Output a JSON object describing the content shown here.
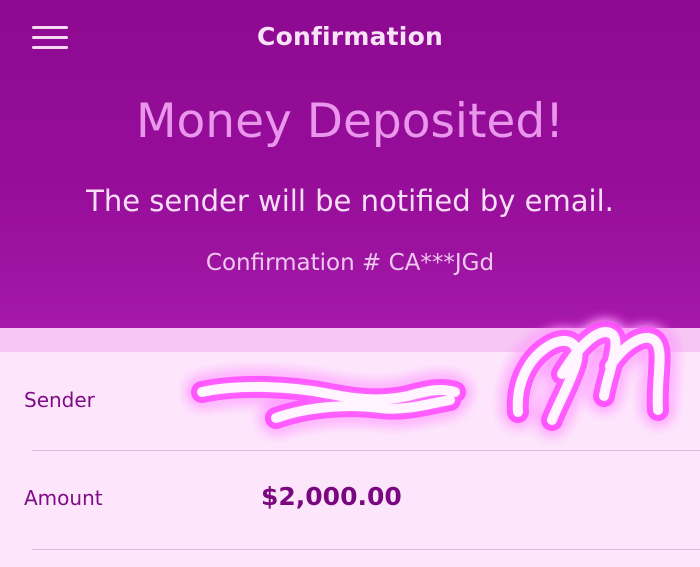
{
  "nav": {
    "title": "Confirmation",
    "menu_icon": "hamburger-menu-icon"
  },
  "confirmation": {
    "headline": "Money Deposited!",
    "message": "The sender will be notified by email.",
    "number_text": "Confirmation # CA***JGd"
  },
  "details": {
    "sender_label": "Sender",
    "amount_label": "Amount",
    "amount_value": "$2,000.00"
  },
  "colors": {
    "header_bg": "#8e0a92",
    "details_bg": "#fde6fc",
    "accent": "#7a077f"
  }
}
